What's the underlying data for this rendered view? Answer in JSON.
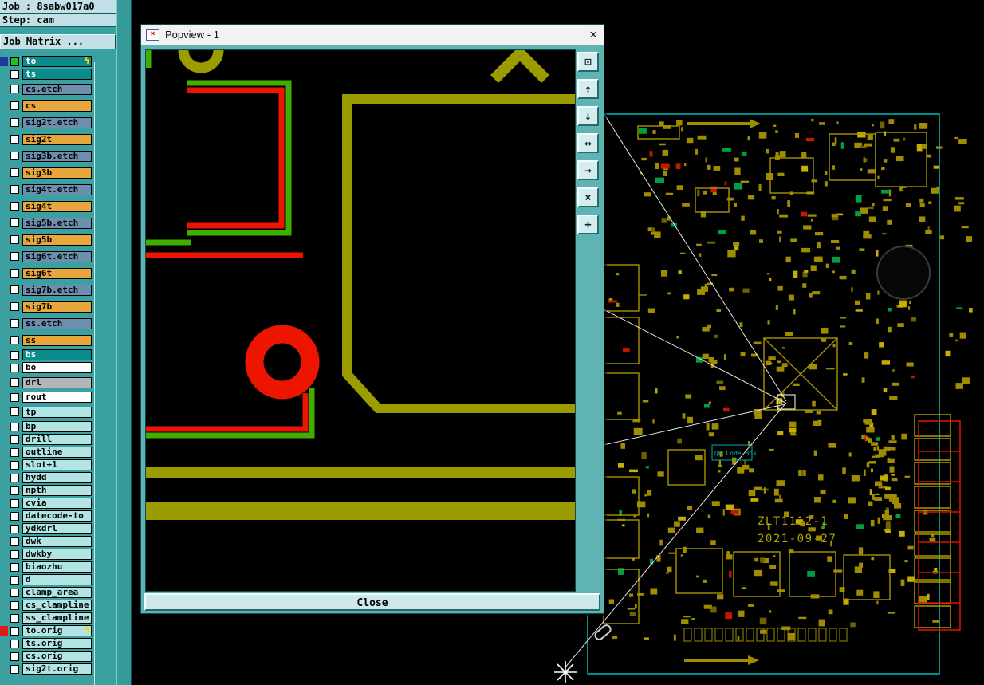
{
  "header": {
    "job": "Job : 8sabw017a0",
    "step": "Step: cam",
    "matrix_button": "Job Matrix ..."
  },
  "icons": {
    "lightning": "ϟ",
    "window_icon_x": "×",
    "titlebar_close": "×"
  },
  "colors": {
    "teal": "#0a8c8c",
    "etch": "#6d8fae",
    "signal": "#e8a73c",
    "misc": "#b2e4e4",
    "white": "#ffffff",
    "gray": "#b6b6b6",
    "blue": "#2038a0",
    "red": "#e01818",
    "green": "#20c020",
    "olive_trace": "#9c9c00",
    "highlight_green": "#3fae00",
    "highlight_red": "#ee1500",
    "board_yellow": "#a08c00",
    "board_cyan": "#00bcbc"
  },
  "layers": [
    {
      "name": "to",
      "style": "teal",
      "indicator": "blue",
      "check": "green",
      "badge": true
    },
    {
      "name": "ts",
      "style": "teal"
    },
    {
      "name": "cs.etch",
      "style": "etch",
      "tall": true
    },
    {
      "name": "cs",
      "style": "signal",
      "tall": true
    },
    {
      "name": "sig2t.etch",
      "style": "etch",
      "tall": true
    },
    {
      "name": "sig2t",
      "style": "signal",
      "tall": true
    },
    {
      "name": "sig3b.etch",
      "style": "etch",
      "tall": true
    },
    {
      "name": "sig3b",
      "style": "signal",
      "tall": true
    },
    {
      "name": "sig4t.etch",
      "style": "etch",
      "tall": true
    },
    {
      "name": "sig4t",
      "style": "signal",
      "tall": true
    },
    {
      "name": "sig5b.etch",
      "style": "etch",
      "tall": true
    },
    {
      "name": "sig5b",
      "style": "signal",
      "tall": true
    },
    {
      "name": "sig6t.etch",
      "style": "etch",
      "tall": true
    },
    {
      "name": "sig6t",
      "style": "signal",
      "tall": true
    },
    {
      "name": "sig7b.etch",
      "style": "etch",
      "tall": true
    },
    {
      "name": "sig7b",
      "style": "signal",
      "tall": true
    },
    {
      "name": "ss.etch",
      "style": "etch",
      "tall": true
    },
    {
      "name": "ss",
      "style": "signal",
      "tall": true
    },
    {
      "name": "bs",
      "style": "teal"
    },
    {
      "name": "bo",
      "style": "white"
    },
    {
      "name": "drl",
      "style": "gray",
      "tall": true
    },
    {
      "name": "rout",
      "style": "white"
    },
    {
      "name": "tp",
      "style": "misc",
      "tall": true
    },
    {
      "name": "bp",
      "style": "misc"
    },
    {
      "name": "drill",
      "style": "misc"
    },
    {
      "name": "outline",
      "style": "misc"
    },
    {
      "name": "slot+1",
      "style": "misc"
    },
    {
      "name": "hydd",
      "style": "misc"
    },
    {
      "name": "npth",
      "style": "misc"
    },
    {
      "name": "cvia",
      "style": "misc"
    },
    {
      "name": "datecode-to",
      "style": "misc"
    },
    {
      "name": "ydkdrl",
      "style": "misc"
    },
    {
      "name": "dwk",
      "style": "misc"
    },
    {
      "name": "dwkby",
      "style": "misc"
    },
    {
      "name": "biaozhu",
      "style": "misc"
    },
    {
      "name": "d",
      "style": "misc"
    },
    {
      "name": "clamp_area",
      "style": "misc"
    },
    {
      "name": "cs_clampline",
      "style": "misc"
    },
    {
      "name": "ss_clampline",
      "style": "misc"
    },
    {
      "name": "to.orig",
      "style": "misc",
      "indicator": "red",
      "badge": true
    },
    {
      "name": "ts.orig",
      "style": "misc"
    },
    {
      "name": "cs.orig",
      "style": "misc"
    },
    {
      "name": "sig2t.orig",
      "style": "misc"
    }
  ],
  "popview": {
    "title": "Popview - 1",
    "close": "Close",
    "tools": [
      {
        "name": "duplicate-view-button",
        "glyph": "⊡"
      },
      {
        "name": "scroll-up-button",
        "glyph": "↑"
      },
      {
        "name": "scroll-down-button",
        "glyph": "↓"
      },
      {
        "name": "scroll-horizontal-button",
        "glyph": "↔"
      },
      {
        "name": "scroll-right-button",
        "glyph": "→"
      },
      {
        "name": "zoom-home-button",
        "glyph": "×"
      },
      {
        "name": "pan-view-button",
        "glyph": "+"
      }
    ]
  },
  "board": {
    "part_number": "ZLT1112-1",
    "date": "2021-09-27",
    "qr_label": "QR Code Box"
  }
}
